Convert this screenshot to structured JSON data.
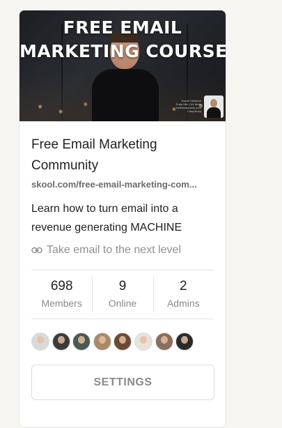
{
  "banner": {
    "title_line1": "FREE EMAIL",
    "title_line2": "MARKETING COURSE",
    "small_print": "Suede Hellebuh\nPraia Ville | NL Bobs\nhellebusbrands.com\nCampShop"
  },
  "group": {
    "title": "Free Email Marketing Community",
    "url": "skool.com/free-email-marketing-com...",
    "description": "Learn how to turn email into a revenue generating MACHINE",
    "link_text": "Take email to the next level"
  },
  "stats": [
    {
      "value": "698",
      "label": "Members"
    },
    {
      "value": "9",
      "label": "Online"
    },
    {
      "value": "2",
      "label": "Admins"
    }
  ],
  "avatars": [
    {
      "name": "member-avatar-1",
      "color": "#d9d9d9"
    },
    {
      "name": "member-avatar-2",
      "color": "#3b3b3b"
    },
    {
      "name": "member-avatar-3",
      "color": "#4a5a52"
    },
    {
      "name": "member-avatar-4",
      "color": "#a88a6a"
    },
    {
      "name": "member-avatar-5",
      "color": "#6b4a34"
    },
    {
      "name": "member-avatar-6",
      "color": "#e9e2da"
    },
    {
      "name": "member-avatar-7",
      "color": "#8a6e5e"
    },
    {
      "name": "member-avatar-8",
      "color": "#2a2a2a"
    }
  ],
  "actions": {
    "settings_label": "SETTINGS"
  },
  "colors": {
    "page_background": "#f7f5f2",
    "card_background": "#ffffff",
    "text_primary": "#202124",
    "text_muted": "#8a8a8a"
  }
}
